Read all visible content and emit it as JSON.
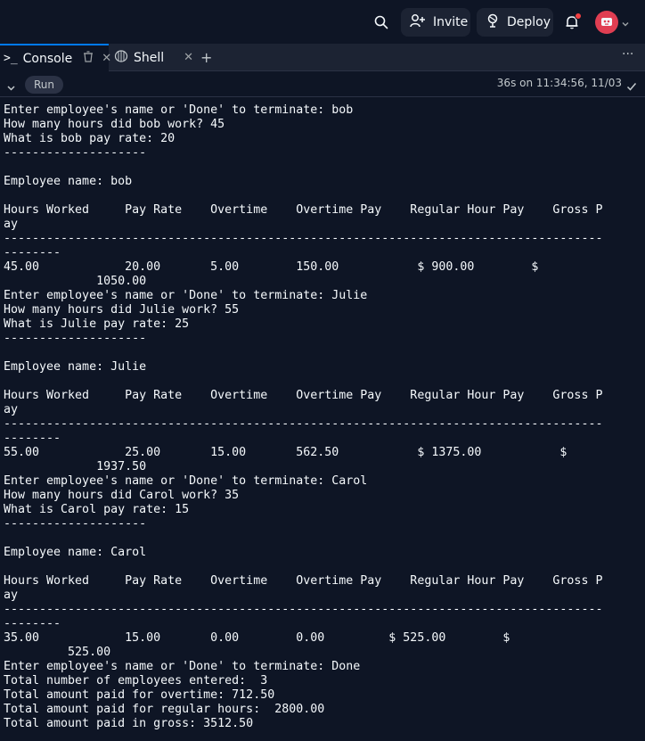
{
  "header": {
    "invite_label": "Invite",
    "deploy_label": "Deploy"
  },
  "tabs": [
    {
      "label": "Console",
      "active": true
    },
    {
      "label": "Shell",
      "active": false
    }
  ],
  "runbar": {
    "run_label": "Run",
    "status_text": "36s on 11:34:56, 11/03"
  },
  "console_lines": [
    "Enter employee's name or 'Done' to terminate: bob",
    "How many hours did bob work? 45",
    "What is bob pay rate: 20",
    "--------------------",
    "",
    "Employee name: bob",
    "",
    "Hours Worked     Pay Rate    Overtime    Overtime Pay    Regular Hour Pay    Gross P",
    "ay",
    "------------------------------------------------------------------------------------",
    "--------",
    "45.00            20.00       5.00        150.00           $ 900.00        $",
    "             1050.00",
    "Enter employee's name or 'Done' to terminate: Julie",
    "How many hours did Julie work? 55",
    "What is Julie pay rate: 25",
    "--------------------",
    "",
    "Employee name: Julie",
    "",
    "Hours Worked     Pay Rate    Overtime    Overtime Pay    Regular Hour Pay    Gross P",
    "ay",
    "------------------------------------------------------------------------------------",
    "--------",
    "55.00            25.00       15.00       562.50           $ 1375.00           $",
    "             1937.50",
    "Enter employee's name or 'Done' to terminate: Carol",
    "How many hours did Carol work? 35",
    "What is Carol pay rate: 15",
    "--------------------",
    "",
    "Employee name: Carol",
    "",
    "Hours Worked     Pay Rate    Overtime    Overtime Pay    Regular Hour Pay    Gross P",
    "ay",
    "------------------------------------------------------------------------------------",
    "--------",
    "35.00            15.00       0.00        0.00         $ 525.00        $",
    "         525.00",
    "Enter employee's name or 'Done' to terminate: Done",
    "Total number of employees entered:  3",
    "Total amount paid for overtime: 712.50",
    "Total amount paid for regular hours:  2800.00",
    "Total amount paid in gross: 3512.50"
  ]
}
